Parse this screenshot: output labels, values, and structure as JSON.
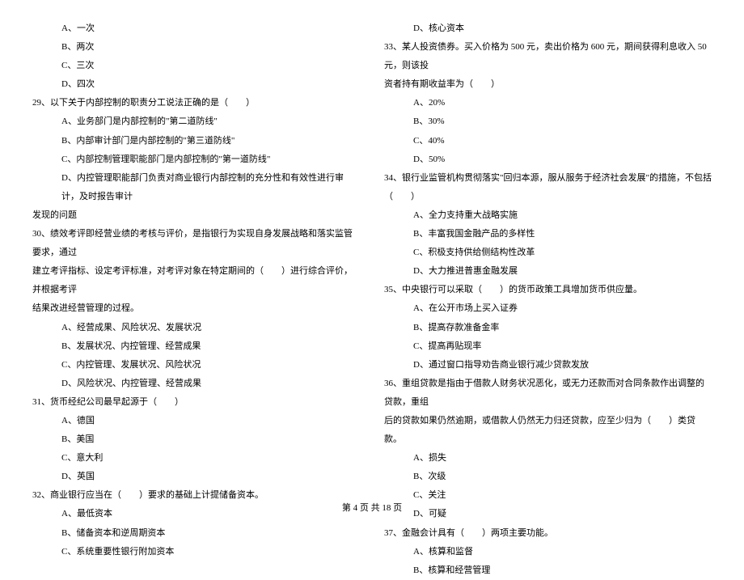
{
  "left_column": {
    "q28_options": [
      "A、一次",
      "B、两次",
      "C、三次",
      "D、四次"
    ],
    "q29": {
      "stem": "29、以下关于内部控制的职责分工说法正确的是（　　）",
      "options": [
        "A、业务部门是内部控制的\"第二道防线\"",
        "B、内部审计部门是内部控制的\"第三道防线\"",
        "C、内部控制管理职能部门是内部控制的\"第一道防线\"",
        "D、内控管理职能部门负责对商业银行内部控制的充分性和有效性进行审计，及时报告审计"
      ],
      "continuation": "发现的问题"
    },
    "q30": {
      "stem_lines": [
        "30、绩效考评即经营业绩的考核与评价，是指银行为实现自身发展战略和落实监管要求，通过",
        "建立考评指标、设定考评标准，对考评对象在特定期间的（　　）进行综合评价，并根据考评",
        "结果改进经营管理的过程。"
      ],
      "options": [
        "A、经营成果、风险状况、发展状况",
        "B、发展状况、内控管理、经营成果",
        "C、内控管理、发展状况、风险状况",
        "D、风险状况、内控管理、经营成果"
      ]
    },
    "q31": {
      "stem": "31、货币经纪公司最早起源于（　　）",
      "options": [
        "A、德国",
        "B、美国",
        "C、意大利",
        "D、英国"
      ]
    },
    "q32": {
      "stem": "32、商业银行应当在（　　）要求的基础上计提储备资本。",
      "options": [
        "A、最低资本",
        "B、储备资本和逆周期资本",
        "C、系统重要性银行附加资本"
      ]
    }
  },
  "right_column": {
    "q32_last_option": "D、核心资本",
    "q33": {
      "stem_lines": [
        "33、某人投资债券。买入价格为 500 元，卖出价格为 600 元，期间获得利息收入 50 元，则该投",
        "资者持有期收益率为（　　）"
      ],
      "options": [
        "A、20%",
        "B、30%",
        "C、40%",
        "D、50%"
      ]
    },
    "q34": {
      "stem": "34、银行业监管机构贯彻落实\"回归本源，服从服务于经济社会发展\"的措施，不包括（　　）",
      "options": [
        "A、全力支持重大战略实施",
        "B、丰富我国金融产品的多样性",
        "C、积极支持供给侧结构性改革",
        "D、大力推进普惠金融发展"
      ]
    },
    "q35": {
      "stem": "35、中央银行可以采取（　　）的货币政策工具增加货币供应量。",
      "options": [
        "A、在公开市场上买入证券",
        "B、提高存款准备金率",
        "C、提高再贴现率",
        "D、通过窗口指导劝告商业银行减少贷款发放"
      ]
    },
    "q36": {
      "stem_lines": [
        "36、重组贷款是指由于借款人财务状况恶化，或无力还款而对合同条款作出调整的贷款，重组",
        "后的贷款如果仍然逾期，或借款人仍然无力归还贷款，应至少归为（　　）类贷款。"
      ],
      "options": [
        "A、损失",
        "B、次级",
        "C、关注",
        "D、可疑"
      ]
    },
    "q37": {
      "stem": "37、金融会计具有（　　）两项主要功能。",
      "options": [
        "A、核算和监督",
        "B、核算和经营管理"
      ]
    }
  },
  "footer": "第 4 页 共 18 页"
}
